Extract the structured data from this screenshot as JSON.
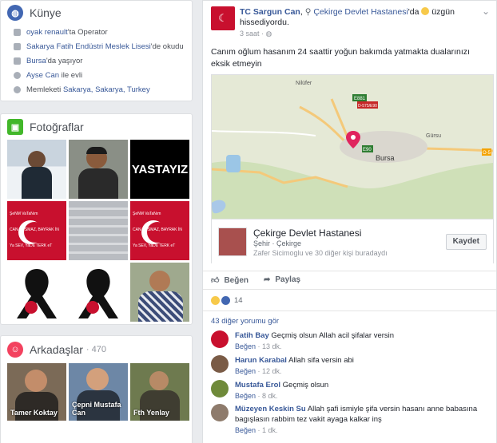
{
  "kunye": {
    "title": "Künye",
    "rows": [
      {
        "icon": "briefcase-icon",
        "link": "oyak renault",
        "text": "'ta Operator"
      },
      {
        "icon": "school-icon",
        "link": "Sakarya Fatih Endüstri Meslek Lisesi",
        "text": "'de okudu"
      },
      {
        "icon": "home-icon",
        "link": "Bursa",
        "text": "'da yaşıyor"
      },
      {
        "icon": "heart-icon",
        "link": "Ayse Can",
        "text": " ile evli"
      },
      {
        "icon": "location-icon",
        "text": "Memleketi ",
        "link": "Sakarya, Sakarya, Turkey"
      }
    ]
  },
  "photos": {
    "title": "Fotoğraflar",
    "tiles": [
      {
        "kind": "person-snow"
      },
      {
        "kind": "person-car"
      },
      {
        "kind": "text",
        "label": "YASTAYIZ"
      },
      {
        "kind": "flag",
        "label": "ŞeNM VaTaNım\nCAN SUSMAZ, BAYRAK İN\nYa SEV, YaDa TERK eT"
      },
      {
        "kind": "papers"
      },
      {
        "kind": "flag",
        "label": "ŞeNM VaTaNım\nCAN SUSMAZ, BAYRAK İN\nYa SEV, YaDa TERK eT"
      },
      {
        "kind": "ribbon"
      },
      {
        "kind": "ribbon"
      },
      {
        "kind": "person-shirt"
      }
    ]
  },
  "friends": {
    "title": "Arkadaşlar",
    "count": "· 470",
    "tiles": [
      {
        "name": "Tamer Koktay"
      },
      {
        "name": "Çepni Mustafa Can"
      },
      {
        "name": "Fth Yenlay"
      }
    ]
  },
  "post": {
    "author": "TC Sargun Can",
    "location_sep": ",",
    "place": "Çekirge Devlet Hastanesi",
    "place_suffix": "'da",
    "feeling": "üzgün",
    "feeling_line2": "hissediyordu.",
    "time": "3 saat",
    "body": "Canım oğlum hasanım 24 saattir yoğun bakımda yatmakta dualarınızı eksik etmeyin",
    "map": {
      "city": "Bursa",
      "town": "Gürsu",
      "district": "Nilüfer",
      "road1": "E881",
      "road2": "D-575/E90",
      "road3": "E90",
      "road4": "O-5"
    },
    "place_card": {
      "name": "Çekirge Devlet Hastanesi",
      "category": "Şehir · Çekirge",
      "checkins_a": "Zafer Sicimoglu",
      "checkins_b": " ve ",
      "checkins_c": "30 diğer kişi",
      "checkins_d": " buradaydı",
      "save_label": "Kaydet"
    },
    "actions": {
      "like": "Beğen",
      "share": "Paylaş"
    },
    "reaction_count": "14",
    "more_comments": "43 diğer yorumu gör",
    "comments": [
      {
        "name": "Fatih Bay",
        "text": "Geçmiş olsun Allah acil şifalar versin",
        "like": "Beğen",
        "time": "13 dk."
      },
      {
        "name": "Harun Karabal",
        "text": "Allah sifa versin abi",
        "like": "Beğen",
        "time": "12 dk."
      },
      {
        "name": "Mustafa Erol",
        "text": "Geçmiş olsun",
        "like": "Beğen",
        "time": "8 dk."
      },
      {
        "name": "Müzeyen Keskin Su",
        "text": "Allah şafi ismiyle şifa versin hasanı anne babasına bagışlasın rabbim tez vakit ayaga kalkar inş",
        "like": "Beğen",
        "time": "1 dk."
      }
    ]
  },
  "colors": {
    "link": "#385898",
    "kunye_icon": "#4267b2",
    "photo_icon": "#42b72a",
    "friends_icon": "#f3425f"
  }
}
